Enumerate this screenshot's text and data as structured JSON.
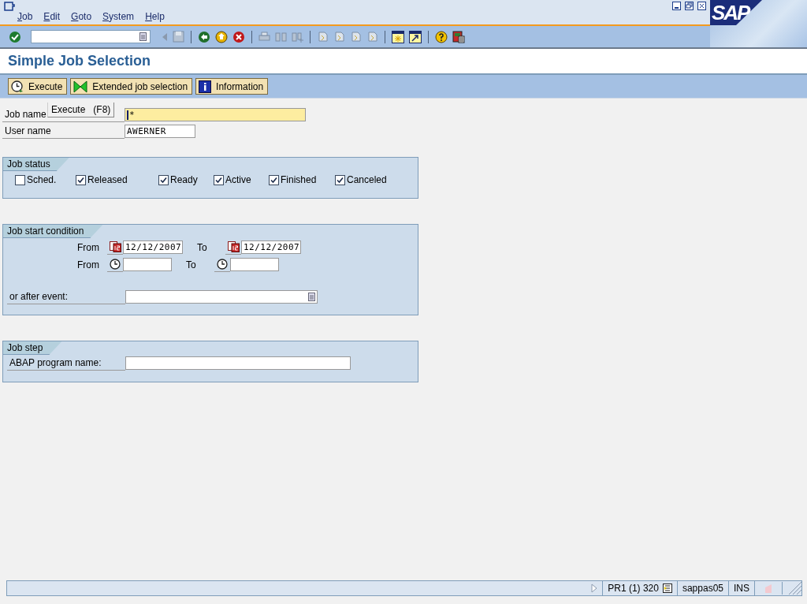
{
  "menu": [
    {
      "label": "Job"
    },
    {
      "label": "Edit"
    },
    {
      "label": "Goto"
    },
    {
      "label": "System"
    },
    {
      "label": "Help"
    }
  ],
  "logo": {
    "text": "SAP"
  },
  "title": "Simple Job Selection",
  "app_toolbar": [
    {
      "label": "Execute",
      "kind": "clock"
    },
    {
      "label": "Extended job selection",
      "kind": "bowtie"
    },
    {
      "label": "Information",
      "kind": "info"
    }
  ],
  "tooltip": "Execute   (F8)",
  "fields": [
    {
      "label": "Job name",
      "value": "*",
      "focused": true
    },
    {
      "label": "User name",
      "value": "AWERNER",
      "focused": false
    }
  ],
  "job_status": {
    "title": "Job status",
    "options": [
      {
        "label": "Sched.",
        "checked": false
      },
      {
        "label": "Released",
        "checked": true
      },
      {
        "label": "Ready",
        "checked": true
      },
      {
        "label": "Active",
        "checked": true
      },
      {
        "label": "Finished",
        "checked": true
      },
      {
        "label": "Canceled",
        "checked": true
      }
    ]
  },
  "job_start_condition": {
    "title": "Job start condition",
    "rows": [
      {
        "kind": "date",
        "from_label": "From",
        "from_value": "12/12/2007",
        "to_label": "To",
        "to_value": "12/12/2007"
      },
      {
        "kind": "time",
        "from_label": "From",
        "to_label": "To"
      }
    ],
    "event_label": "or after event:"
  },
  "job_step": {
    "title": "Job step",
    "program_label": "ABAP program name:"
  },
  "status_bar": {
    "system": "PR1 (1) 320",
    "server": "sappas05",
    "mode": "INS"
  }
}
